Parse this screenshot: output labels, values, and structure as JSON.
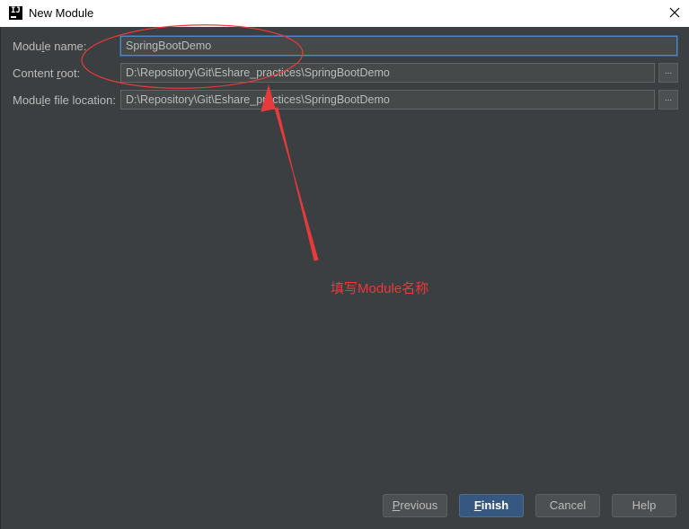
{
  "window": {
    "title": "New Module",
    "app_icon_glyph": "IJ"
  },
  "form": {
    "module_name": {
      "label_pre": "Modu",
      "label_mn": "l",
      "label_post": "e name:",
      "value": "SpringBootDemo"
    },
    "content_root": {
      "label_pre": "Content ",
      "label_mn": "r",
      "label_post": "oot:",
      "value": "D:\\Repository\\Git\\Eshare_practices\\SpringBootDemo",
      "browse_label": "..."
    },
    "module_file_location": {
      "label_pre": "Modu",
      "label_mn": "l",
      "label_post": "e file location:",
      "value": "D:\\Repository\\Git\\Eshare_practices\\SpringBootDemo",
      "browse_label": "..."
    }
  },
  "annotation": {
    "text": "填写Module名称",
    "color": "#e83a3a"
  },
  "buttons": {
    "previous": {
      "mn": "P",
      "rest": "revious"
    },
    "finish": {
      "mn": "F",
      "rest": "inish"
    },
    "cancel": {
      "label": "Cancel"
    },
    "help": {
      "label": "Help"
    }
  },
  "colors": {
    "background": "#3c3f41",
    "focus_border": "#4a88c7",
    "default_button": "#365880"
  }
}
